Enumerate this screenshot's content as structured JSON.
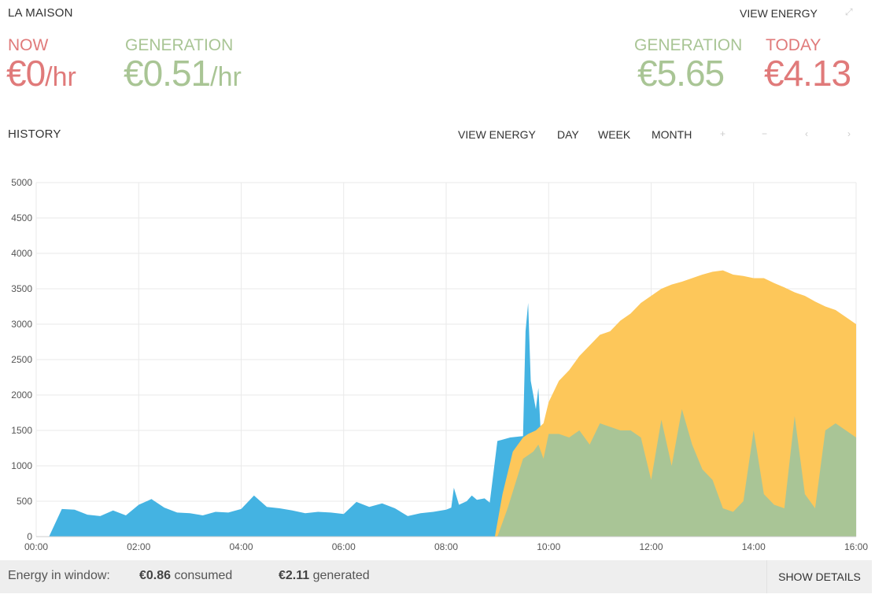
{
  "header": {
    "title": "LA MAISON",
    "view_energy": "VIEW ENERGY",
    "expand_icon": "expand-icon"
  },
  "stats": {
    "now_label": "NOW",
    "now_value": "€0",
    "now_unit": "/hr",
    "gen_rate_label": "GENERATION",
    "gen_rate_value": "€0.51",
    "gen_rate_unit": "/hr",
    "gen_total_label": "GENERATION",
    "gen_total_value": "€5.65",
    "today_label": "TODAY",
    "today_value": "€4.13"
  },
  "history": {
    "title": "HISTORY",
    "view_energy": "VIEW ENERGY",
    "day": "DAY",
    "week": "WEEK",
    "month": "MONTH",
    "icons": [
      "zoom-in-icon",
      "zoom-out-icon",
      "prev-icon",
      "next-icon"
    ]
  },
  "footer": {
    "label": "Energy in window:",
    "consumed_value": "€0.86",
    "consumed_text": "consumed",
    "generated_value": "€2.11",
    "generated_text": "generated",
    "details_button": "SHOW DETAILS"
  },
  "colors": {
    "red": "#e07a7a",
    "green": "#a9c595",
    "use": "#44b3e2",
    "solar": "#fdc75a",
    "self": "#a9c596"
  },
  "chart_data": {
    "type": "area",
    "title": "",
    "xlabel": "",
    "ylabel": "",
    "ylim": [
      0,
      5000
    ],
    "yticks": [
      "0",
      "500",
      "1000",
      "1500",
      "2000",
      "2500",
      "3000",
      "3500",
      "4000",
      "4500",
      "5000"
    ],
    "xlim": [
      0,
      16
    ],
    "xticks": [
      "00:00",
      "02:00",
      "04:00",
      "06:00",
      "08:00",
      "10:00",
      "12:00",
      "14:00",
      "16:00"
    ],
    "grid": true,
    "series": [
      {
        "key": "use",
        "x": [
          0.25,
          0.5,
          0.75,
          1.0,
          1.25,
          1.5,
          1.75,
          2.0,
          2.25,
          2.5,
          2.75,
          3.0,
          3.25,
          3.5,
          3.75,
          4.0,
          4.25,
          4.5,
          4.75,
          5.0,
          5.25,
          5.5,
          5.75,
          6.0,
          6.25,
          6.5,
          6.75,
          7.0,
          7.25,
          7.5,
          7.75,
          8.0,
          8.1,
          8.15,
          8.25,
          8.4,
          8.5,
          8.6,
          8.75,
          8.85,
          9.0,
          9.25,
          9.5,
          9.55,
          9.6,
          9.65,
          9.75,
          9.8,
          9.85,
          9.9,
          10.0,
          10.1,
          10.2,
          10.3,
          10.4,
          10.5,
          10.6,
          10.7,
          10.8,
          10.9,
          11.0,
          11.1,
          11.2,
          11.3,
          11.4,
          11.5,
          11.6,
          11.7,
          11.8,
          11.9,
          12.0,
          12.1,
          12.2,
          12.3,
          12.4,
          12.5,
          12.6,
          12.8,
          13.0,
          13.2,
          13.4,
          13.6,
          13.8,
          14.0,
          14.2,
          14.4,
          14.6,
          14.8,
          15.0,
          15.2,
          15.4,
          15.6,
          15.8,
          16.0
        ],
        "values": [
          0,
          390,
          380,
          310,
          290,
          370,
          300,
          450,
          530,
          410,
          340,
          330,
          300,
          350,
          340,
          390,
          580,
          420,
          400,
          370,
          330,
          350,
          340,
          320,
          490,
          420,
          470,
          400,
          290,
          330,
          350,
          380,
          410,
          690,
          450,
          500,
          580,
          520,
          540,
          480,
          1350,
          1400,
          1420,
          2900,
          3300,
          2200,
          1800,
          2100,
          1400,
          1500,
          1800,
          1500,
          1900,
          1600,
          2000,
          1700,
          1500,
          1800,
          900,
          1600,
          400,
          1200,
          700,
          1500,
          500,
          1000,
          1300,
          600,
          1500,
          1200,
          800,
          1600,
          1000,
          1900,
          1400,
          1200,
          800,
          700,
          900,
          400,
          300,
          1100,
          400,
          1600,
          600,
          450,
          1100,
          1200,
          600,
          1700,
          1600,
          1500,
          1400,
          1500
        ]
      },
      {
        "key": "solar",
        "x": [
          8.95,
          9.1,
          9.3,
          9.5,
          9.6,
          9.75,
          9.9,
          10.0,
          10.2,
          10.4,
          10.6,
          10.8,
          11.0,
          11.2,
          11.4,
          11.6,
          11.8,
          12.0,
          12.2,
          12.4,
          12.6,
          12.8,
          13.0,
          13.2,
          13.4,
          13.6,
          13.8,
          14.0,
          14.2,
          14.4,
          14.6,
          14.8,
          15.0,
          15.2,
          15.4,
          15.6,
          15.8,
          16.0
        ],
        "values": [
          0,
          600,
          1200,
          1400,
          1450,
          1500,
          1600,
          1900,
          2200,
          2350,
          2550,
          2700,
          2850,
          2900,
          3050,
          3150,
          3300,
          3400,
          3500,
          3560,
          3600,
          3650,
          3700,
          3740,
          3760,
          3700,
          3680,
          3650,
          3650,
          3580,
          3520,
          3450,
          3400,
          3320,
          3250,
          3200,
          3100,
          3000
        ]
      },
      {
        "key": "self",
        "x": [
          9.0,
          9.2,
          9.5,
          9.7,
          9.8,
          9.9,
          10.0,
          10.2,
          10.4,
          10.6,
          10.8,
          11.0,
          11.2,
          11.4,
          11.6,
          11.8,
          12.0,
          12.2,
          12.4,
          12.6,
          12.8,
          13.0,
          13.2,
          13.4,
          13.6,
          13.8,
          14.0,
          14.2,
          14.4,
          14.6,
          14.8,
          15.0,
          15.2,
          15.4,
          15.6,
          15.8,
          16.0
        ],
        "values": [
          0,
          400,
          1100,
          1200,
          1300,
          1100,
          1450,
          1450,
          1400,
          1500,
          1300,
          1600,
          1550,
          1500,
          1500,
          1400,
          800,
          1650,
          1000,
          1800,
          1300,
          950,
          800,
          400,
          350,
          500,
          1500,
          600,
          450,
          400,
          1700,
          600,
          400,
          1500,
          1600,
          1500,
          1400
        ]
      }
    ]
  }
}
